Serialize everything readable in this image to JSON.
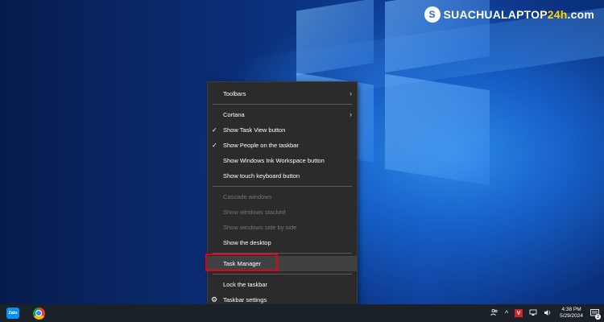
{
  "watermark": {
    "brand_main": "SUACHUALAPTOP",
    "brand_accent": "24h",
    "brand_suffix": ".com",
    "icon": "sc-logo-icon"
  },
  "menu": {
    "toolbars": "Toolbars",
    "cortana": "Cortana",
    "show_task_view": "Show Task View button",
    "show_people": "Show People on the taskbar",
    "show_ink": "Show Windows Ink Workspace button",
    "show_touch_keyboard": "Show touch keyboard button",
    "cascade": "Cascade windows",
    "stacked": "Show windows stacked",
    "side_by_side": "Show windows side by side",
    "show_desktop": "Show the desktop",
    "task_manager": "Task Manager",
    "lock_taskbar": "Lock the taskbar",
    "taskbar_settings": "Taskbar settings",
    "check_glyph": "✓",
    "arrow_glyph": "›",
    "gear_glyph": "⚙"
  },
  "taskbar": {
    "apps": [
      {
        "name": "Zalo",
        "label": "Zalo",
        "icon": "zalo-icon"
      },
      {
        "name": "Chrome",
        "icon": "chrome-icon"
      }
    ],
    "tray": {
      "people_icon": "people-icon",
      "chevron": "^",
      "av_badge": "V",
      "network_icon": "network-icon",
      "volume_icon": "volume-icon"
    },
    "clock_time": "4:38 PM",
    "clock_date": "5/29/2024",
    "notifications_count": "2"
  },
  "colors": {
    "highlight": "#e3001b",
    "menu_bg": "#2b2b2b",
    "taskbar_bg": "#1b2129"
  }
}
